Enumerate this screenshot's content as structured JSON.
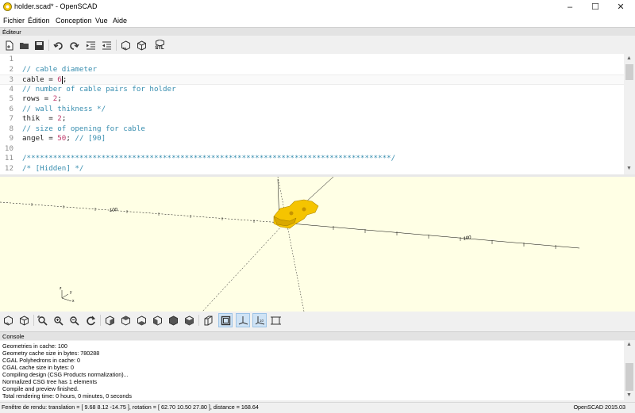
{
  "window": {
    "title": "holder.scad* - OpenSCAD",
    "controls": [
      "–",
      "☐",
      "✕"
    ]
  },
  "menu": [
    "Fichier",
    "Édition",
    "Conception",
    "Vue",
    "Aide"
  ],
  "editor_panel": {
    "title": "Éditeur",
    "toolbar_icons": [
      "new-file-icon",
      "open-file-icon",
      "save-icon",
      "undo-icon",
      "redo-icon",
      "indent-icon",
      "unindent-icon",
      "preview-icon",
      "render-icon",
      "export-stl-icon"
    ],
    "stl_label": "STL"
  },
  "code": {
    "current_line": 3,
    "lines": [
      {
        "n": "1",
        "t": []
      },
      {
        "n": "2",
        "t": [
          {
            "c": "com",
            "s": "// cable diameter"
          }
        ]
      },
      {
        "n": "3",
        "t": [
          {
            "c": "txt",
            "s": "cable = "
          },
          {
            "c": "num",
            "s": "6"
          },
          {
            "c": "txt",
            "s": ";"
          }
        ]
      },
      {
        "n": "4",
        "t": [
          {
            "c": "com",
            "s": "// number of cable pairs for holder"
          }
        ]
      },
      {
        "n": "5",
        "t": [
          {
            "c": "txt",
            "s": "rows = "
          },
          {
            "c": "num",
            "s": "2"
          },
          {
            "c": "txt",
            "s": ";"
          }
        ]
      },
      {
        "n": "6",
        "t": [
          {
            "c": "com",
            "s": "// wall thikness */"
          }
        ]
      },
      {
        "n": "7",
        "t": [
          {
            "c": "txt",
            "s": "thik  = "
          },
          {
            "c": "num",
            "s": "2"
          },
          {
            "c": "txt",
            "s": ";"
          }
        ]
      },
      {
        "n": "8",
        "t": [
          {
            "c": "com",
            "s": "// size of opening for cable"
          }
        ]
      },
      {
        "n": "9",
        "t": [
          {
            "c": "txt",
            "s": "angel = "
          },
          {
            "c": "num",
            "s": "50"
          },
          {
            "c": "txt",
            "s": "; "
          },
          {
            "c": "com",
            "s": "// [90]"
          }
        ]
      },
      {
        "n": "10",
        "t": []
      },
      {
        "n": "11",
        "t": [
          {
            "c": "com",
            "s": "/***********************************************************************************/"
          }
        ]
      },
      {
        "n": "12",
        "t": [
          {
            "c": "com",
            "s": "/* [Hidden] */"
          }
        ]
      }
    ]
  },
  "viewport": {
    "scale_label_left": "100",
    "scale_label_right": "100",
    "axis_label_y": "y",
    "axis_label_x": "x",
    "axis_label_z": "z"
  },
  "view_toolbar": {
    "icons": [
      "preview-view-icon",
      "render-view-icon",
      "view-all-icon",
      "zoom-in-icon",
      "zoom-out-icon",
      "reset-view-icon",
      "view-right-icon",
      "view-top-icon",
      "view-bottom-icon",
      "view-left-icon",
      "view-front-icon",
      "view-back-icon",
      "perspective-icon",
      "orthogonal-icon",
      "show-axes-icon",
      "show-scale-icon",
      "show-edges-icon"
    ],
    "scale_toggle_label": "10"
  },
  "console": {
    "title": "Console",
    "lines": [
      "Geometries in cache: 100",
      "Geometry cache size in bytes: 780288",
      "CGAL Polyhedrons in cache: 0",
      "CGAL cache size in bytes: 0",
      "Compiling design (CSG Products normalization)...",
      "Normalized CSG tree has 1 elements",
      "Compile and preview finished.",
      "Total rendering time: 0 hours, 0 minutes, 0 seconds"
    ]
  },
  "status": {
    "left": "Fenêtre de rendu: translation = [ 9.68 8.12 -14.75 ], rotation = [ 62.70 10.50 27.80 ], distance = 168.64",
    "right": "OpenSCAD 2015.03"
  },
  "colors": {
    "viewport_bg": "#ffffe5",
    "model": "#f5c400",
    "comment": "#3a8fb0",
    "number": "#c0396a"
  }
}
